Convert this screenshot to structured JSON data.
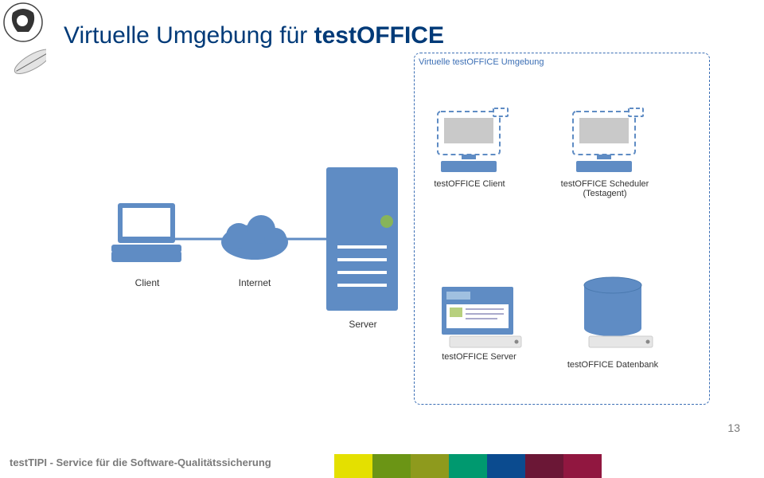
{
  "title_prefix": "Virtuelle Umgebung für ",
  "title_bold": "testOFFICE",
  "env_label": "Virtuelle testOFFICE Umgebung",
  "labels": {
    "client": "Client",
    "internet": "Internet",
    "server": "Server",
    "to_client": "testOFFICE Client",
    "to_scheduler": "testOFFICE Scheduler",
    "testagent": "(Testagent)",
    "to_server": "testOFFICE Server",
    "to_db": "testOFFICE Datenbank"
  },
  "footer": "testTIPI - Service für die Software-Qualitätssicherung",
  "page": "13",
  "swatch_colors": [
    "#e4e000",
    "#6b9515",
    "#8e9a1d",
    "#00996f",
    "#0b4b8f",
    "#6b1736",
    "#911740"
  ]
}
